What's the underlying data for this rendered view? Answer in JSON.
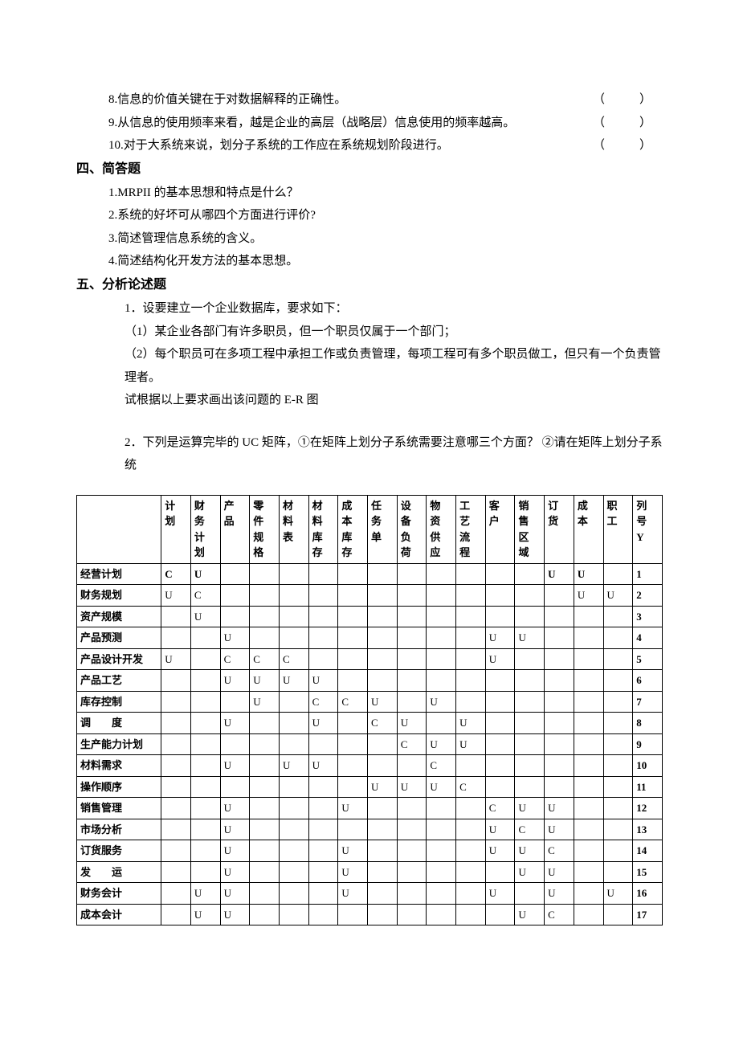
{
  "tf": {
    "items": [
      {
        "n": "8.",
        "t": "信息的价值关键在于对数据解释的正确性。"
      },
      {
        "n": "9.",
        "t": "从信息的使用频率来看，越是企业的高层（战略层）信息使用的频率越高。"
      },
      {
        "n": "10.",
        "t": "对于大系统来说，划分子系统的工作应在系统规划阶段进行。"
      }
    ],
    "paren": "（　）"
  },
  "sec4": {
    "heading": "四、简答题",
    "items": [
      "1.MRPII 的基本思想和特点是什么？",
      "2.系统的好坏可从哪四个方面进行评价?",
      "3.简述管理信息系统的含义。",
      "4.简述结构化开发方法的基本思想。"
    ]
  },
  "sec5": {
    "heading": "五、分析论述题",
    "q1_lines": [
      "1．设要建立一个企业数据库，要求如下：",
      "（1）某企业各部门有许多职员，但一个职员仅属于一个部门；",
      "（2）每个职员可在多项工程中承担工作或负责管理，每项工程可有多个职员做工，但只有一个负责管理者。",
      "试根据以上要求画出该问题的 E-R 图"
    ],
    "q2_lines": [
      "2．下列是运算完毕的 UC 矩阵，①在矩阵上划分子系统需要注意哪三个方面？ ②请在矩阵上划分子系统"
    ]
  },
  "uc": {
    "col_headers": [
      "计划",
      "财务计划",
      "产品",
      "零件规格",
      "材料表",
      "材料库存",
      "成本库存",
      "任务单",
      "设备负荷",
      "物资供应",
      "工艺流程",
      "客户",
      "销售区域",
      "订货",
      "成本",
      "职工",
      "列号Y"
    ],
    "rows": [
      {
        "h": "经营计划",
        "c": [
          "C",
          "U",
          "",
          "",
          "",
          "",
          "",
          "",
          "",
          "",
          "",
          "",
          "",
          "U",
          "U",
          "",
          "1"
        ],
        "bold": true
      },
      {
        "h": "财务规划",
        "c": [
          "U",
          "C",
          "",
          "",
          "",
          "",
          "",
          "",
          "",
          "",
          "",
          "",
          "",
          "",
          "U",
          "U",
          "2"
        ]
      },
      {
        "h": "资产规模",
        "c": [
          "",
          "U",
          "",
          "",
          "",
          "",
          "",
          "",
          "",
          "",
          "",
          "",
          "",
          "",
          "",
          "",
          "3"
        ]
      },
      {
        "h": "产品预测",
        "c": [
          "",
          "",
          "U",
          "",
          "",
          "",
          "",
          "",
          "",
          "",
          "",
          "U",
          "U",
          "",
          "",
          "",
          "4"
        ]
      },
      {
        "h": "产品设计开发",
        "c": [
          "U",
          "",
          "C",
          "C",
          "C",
          "",
          "",
          "",
          "",
          "",
          "",
          "U",
          "",
          "",
          "",
          "",
          "5"
        ]
      },
      {
        "h": "产品工艺",
        "c": [
          "",
          "",
          "U",
          "U",
          "U",
          "U",
          "",
          "",
          "",
          "",
          "",
          "",
          "",
          "",
          "",
          "",
          "6"
        ]
      },
      {
        "h": "库存控制",
        "c": [
          "",
          "",
          "",
          "U",
          "",
          "C",
          "C",
          "U",
          "",
          "U",
          "",
          "",
          "",
          "",
          "",
          "",
          "7"
        ]
      },
      {
        "h": "调　　度",
        "c": [
          "",
          "",
          "U",
          "",
          "",
          "U",
          "",
          "C",
          "U",
          "",
          "U",
          "",
          "",
          "",
          "",
          "",
          "8"
        ]
      },
      {
        "h": "生产能力计划",
        "c": [
          "",
          "",
          "",
          "",
          "",
          "",
          "",
          "",
          "C",
          "U",
          "U",
          "",
          "",
          "",
          "",
          "",
          "9"
        ]
      },
      {
        "h": "材料需求",
        "c": [
          "",
          "",
          "U",
          "",
          "U",
          "U",
          "",
          "",
          "",
          "C",
          "",
          "",
          "",
          "",
          "",
          "",
          "10"
        ]
      },
      {
        "h": "操作顺序",
        "c": [
          "",
          "",
          "",
          "",
          "",
          "",
          "",
          "U",
          "U",
          "U",
          "C",
          "",
          "",
          "",
          "",
          "",
          "11"
        ]
      },
      {
        "h": "销售管理",
        "c": [
          "",
          "",
          "U",
          "",
          "",
          "",
          "U",
          "",
          "",
          "",
          "",
          "C",
          "U",
          "U",
          "",
          "",
          "12"
        ]
      },
      {
        "h": "市场分析",
        "c": [
          "",
          "",
          "U",
          "",
          "",
          "",
          "",
          "",
          "",
          "",
          "",
          "U",
          "C",
          "U",
          "",
          "",
          "13"
        ]
      },
      {
        "h": "订货服务",
        "c": [
          "",
          "",
          "U",
          "",
          "",
          "",
          "U",
          "",
          "",
          "",
          "",
          "U",
          "U",
          "C",
          "",
          "",
          "14"
        ]
      },
      {
        "h": "发　　运",
        "c": [
          "",
          "",
          "U",
          "",
          "",
          "",
          "U",
          "",
          "",
          "",
          "",
          "",
          "U",
          "U",
          "",
          "",
          "15"
        ]
      },
      {
        "h": "财务会计",
        "c": [
          "",
          "U",
          "U",
          "",
          "",
          "",
          "U",
          "",
          "",
          "",
          "",
          "U",
          "",
          "U",
          "",
          "U",
          "16"
        ]
      },
      {
        "h": "成本会计",
        "c": [
          "",
          "U",
          "U",
          "",
          "",
          "",
          "",
          "",
          "",
          "",
          "",
          "",
          "U",
          "C",
          "",
          "",
          "17"
        ]
      }
    ]
  }
}
